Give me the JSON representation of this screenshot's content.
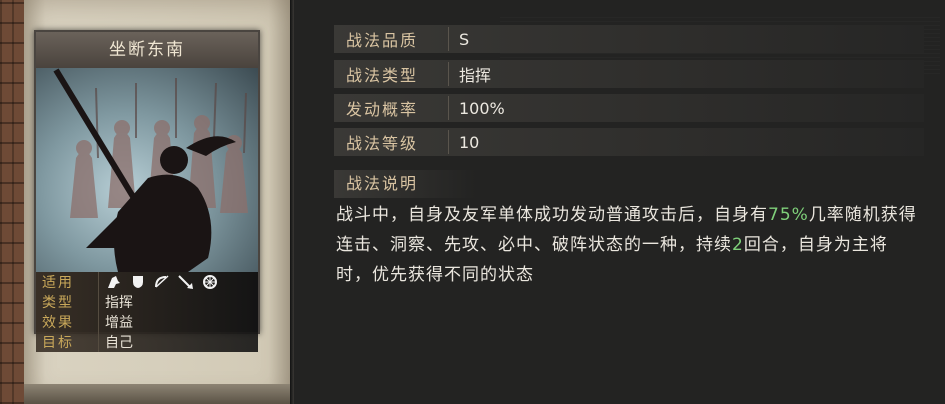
{
  "skill": {
    "name": "坐断东南",
    "props": [
      {
        "label": "适用",
        "icons": [
          "cavalry-icon",
          "shield-icon",
          "bow-icon",
          "spear-icon",
          "wheel-icon"
        ]
      },
      {
        "label": "类型",
        "value": "指挥"
      },
      {
        "label": "效果",
        "value": "增益"
      },
      {
        "label": "目标",
        "value": "自己"
      }
    ]
  },
  "details": [
    {
      "label": "战法品质",
      "value": "S"
    },
    {
      "label": "战法类型",
      "value": "指挥"
    },
    {
      "label": "发动概率",
      "value": "100%"
    },
    {
      "label": "战法等级",
      "value": "10"
    }
  ],
  "description": {
    "title": "战法说明",
    "parts": [
      {
        "text": "战斗中，自身及友军单体成功发动普通攻击后，自身有",
        "highlight": false
      },
      {
        "text": "75%",
        "highlight": true
      },
      {
        "text": "几率随机获得连击、洞察、先攻、必中、破阵状态的一种，持续",
        "highlight": false
      },
      {
        "text": "2",
        "highlight": true
      },
      {
        "text": "回合，自身为主将时，优先获得不同的状态",
        "highlight": false
      }
    ]
  },
  "colors": {
    "label": "#d9c4a2",
    "highlight": "#7fd07a",
    "prop_label": "#c9a85a"
  }
}
